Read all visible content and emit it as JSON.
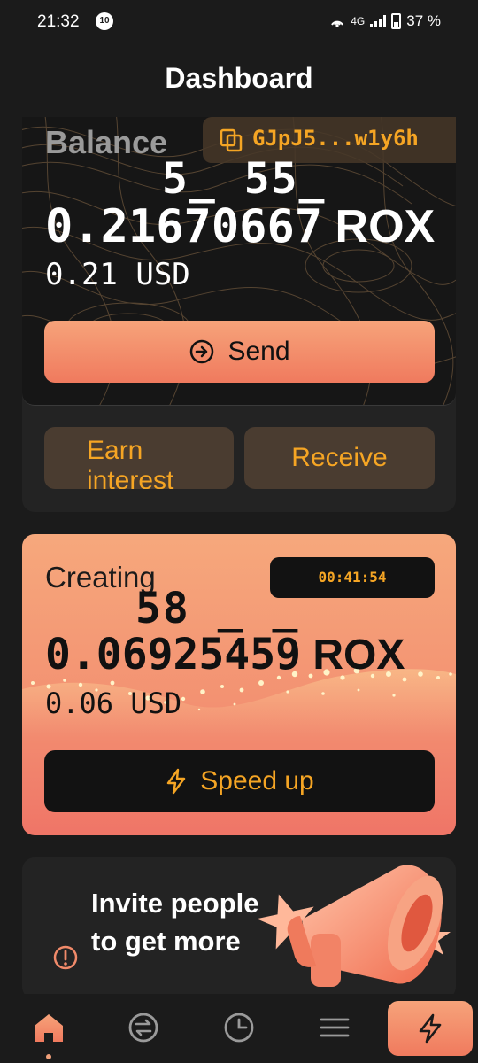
{
  "status_bar": {
    "time": "21:32",
    "badge": "10",
    "network": "4G",
    "battery": "37 %"
  },
  "header": {
    "title": "Dashboard"
  },
  "balance_card": {
    "label": "Balance",
    "address": "GJpJ5...w1y6h",
    "overlay_digits": "5_ 55_",
    "amount": "0.21670667",
    "unit": "ROX",
    "usd": "0.21 USD",
    "send_label": "Send",
    "earn_label": "Earn interest",
    "receive_label": "Receive"
  },
  "creating_card": {
    "label": "Creating",
    "timer": "00:41:54",
    "overlay_digits": "58 _ _",
    "amount": "0.06925459",
    "unit": "ROX",
    "usd": "0.06 USD",
    "speed_label": "Speed up"
  },
  "invite_card": {
    "text": "Invite people to get more"
  },
  "nav": {
    "items": [
      "home-icon",
      "exchange-icon",
      "history-icon",
      "menu-icon",
      "bolt-icon"
    ],
    "active": "home-icon"
  },
  "colors": {
    "accent": "#f5a524",
    "peach": "#f39272",
    "background": "#1b1b1b",
    "card": "#232323"
  }
}
